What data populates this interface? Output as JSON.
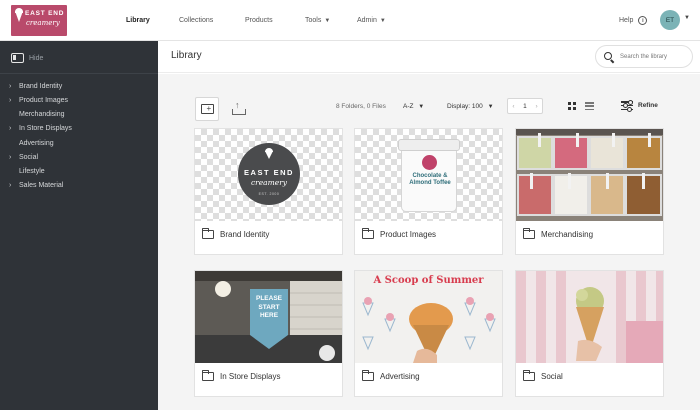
{
  "brand": {
    "logo_line1": "EAST END",
    "logo_line2": "creamery",
    "logo_color": "#b94a6b"
  },
  "nav": {
    "items": [
      {
        "label": "Library",
        "active": true,
        "dropdown": false
      },
      {
        "label": "Collections",
        "active": false,
        "dropdown": false
      },
      {
        "label": "Products",
        "active": false,
        "dropdown": false
      },
      {
        "label": "Tools",
        "active": false,
        "dropdown": true
      },
      {
        "label": "Admin",
        "active": false,
        "dropdown": true
      }
    ],
    "help_label": "Help",
    "user_initials": "ET"
  },
  "sidebar": {
    "hide_label": "Hide",
    "items": [
      {
        "label": "Brand Identity",
        "expandable": true,
        "level": 0
      },
      {
        "label": "Product Images",
        "expandable": true,
        "level": 0
      },
      {
        "label": "Merchandising",
        "expandable": false,
        "level": 1
      },
      {
        "label": "In Store Displays",
        "expandable": true,
        "level": 0
      },
      {
        "label": "Advertising",
        "expandable": false,
        "level": 1
      },
      {
        "label": "Social",
        "expandable": true,
        "level": 0
      },
      {
        "label": "Lifestyle",
        "expandable": false,
        "level": 1
      },
      {
        "label": "Sales Material",
        "expandable": true,
        "level": 0
      }
    ]
  },
  "page": {
    "title": "Library",
    "search_placeholder": "Search the library"
  },
  "toolbar": {
    "counts": "8 Folders, 0 Files",
    "sort": "A-Z",
    "display": "Display: 100",
    "page": "1",
    "refine_label": "Refine"
  },
  "folders": [
    {
      "name": "Brand Identity",
      "thumb": "logo"
    },
    {
      "name": "Product Images",
      "thumb": "product"
    },
    {
      "name": "Merchandising",
      "thumb": "gelato-case"
    },
    {
      "name": "In Store Displays",
      "thumb": "store-sign"
    },
    {
      "name": "Advertising",
      "thumb": "poster"
    },
    {
      "name": "Social",
      "thumb": "cone-photo"
    }
  ],
  "thumb_text": {
    "logo_line1": "EAST END",
    "logo_line2": "creamery",
    "logo_line3": "EST. 2000",
    "tub_line1": "Chocolate &",
    "tub_line2": "Almond Toffee",
    "sign_line1": "PLEASE",
    "sign_line2": "START",
    "sign_line3": "HERE",
    "poster_title": "A Scoop of Summer"
  },
  "colors": {
    "sidebar_bg": "#2f3338",
    "avatar_bg": "#7bb3b6",
    "content_bg": "#f4f4f4"
  },
  "icons": [
    "sidebar-toggle-icon",
    "search-icon",
    "help-icon",
    "new-folder-icon",
    "upload-icon",
    "grid-view-icon",
    "list-view-icon",
    "refine-icon",
    "folder-icon",
    "chevron-down-icon",
    "chevron-right-icon"
  ]
}
